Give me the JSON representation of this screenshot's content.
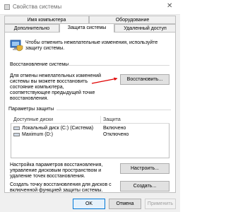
{
  "window": {
    "title": "Свойства системы",
    "close_glyph": "✕"
  },
  "tabs_row1": [
    {
      "label": "Имя компьютера"
    },
    {
      "label": "Оборудование"
    }
  ],
  "tabs_row2": [
    {
      "label": "Дополнительно"
    },
    {
      "label": "Защита системы",
      "active": true
    },
    {
      "label": "Удаленный доступ"
    }
  ],
  "intro": {
    "text_line1": "Чтобы отменить нежелательные изменения, используйте",
    "text_line2": "защиту системы."
  },
  "restore": {
    "section_title": "Восстановление системы",
    "desc": [
      "Для отмены нежелательных изменений",
      "системы вы можете восстановить",
      "состояние компьютера,",
      "соответствующее предыдущей точке",
      "восстановления."
    ],
    "button": "Восстановить..."
  },
  "protection": {
    "section_title": "Параметры защиты",
    "columns": [
      "Доступные диски",
      "Защита"
    ],
    "rows": [
      {
        "drive": "Локальный диск (C:) (Система)",
        "status": "Включено",
        "icon": "drive-icon"
      },
      {
        "drive": "Maximum (D:)",
        "status": "Отключено",
        "icon": "drive-icon"
      }
    ]
  },
  "configure": {
    "desc": [
      "Настройка параметров восстановления,",
      "управление дисковым пространством и",
      "удаление точек восстановления."
    ],
    "button": "Настроить..."
  },
  "create": {
    "desc": [
      "Создать точку восстановления для дисков с",
      "включенной функцией защиты системы."
    ],
    "button": "Создать..."
  },
  "footer": {
    "ok": "OK",
    "cancel": "Отмена",
    "apply": "Применить"
  }
}
